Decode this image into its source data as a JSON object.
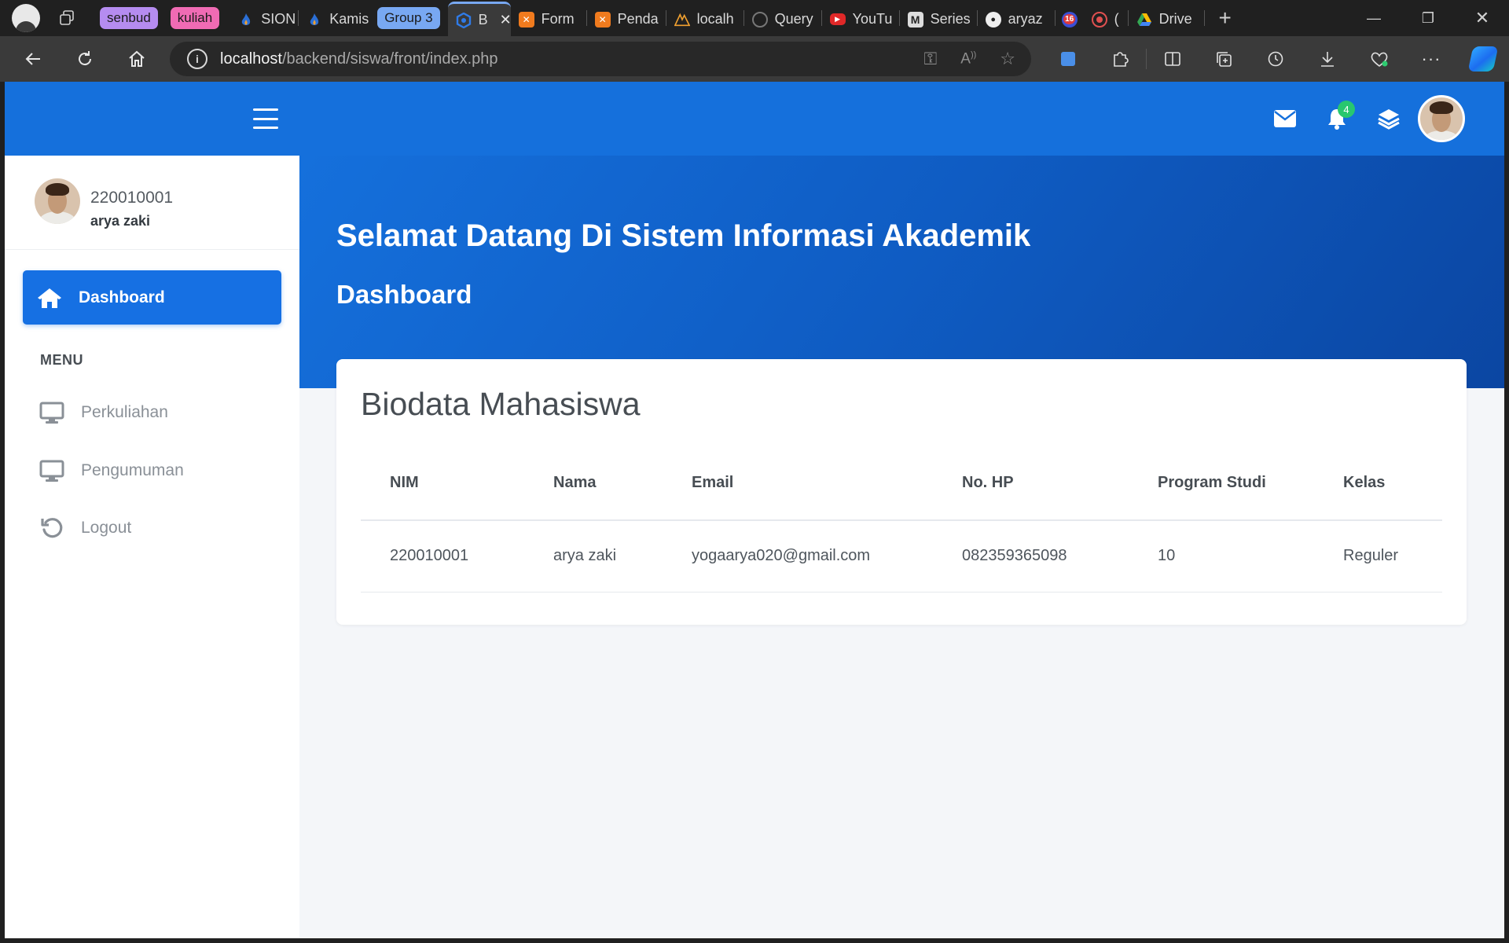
{
  "browser": {
    "tab_groups": [
      {
        "label": "senbud",
        "color": "#b58cf0"
      },
      {
        "label": "kuliah",
        "color": "#f06bb4"
      }
    ],
    "tabs": [
      {
        "title": "SION",
        "favicon": "flame-icon",
        "color": "#2b6fd6"
      },
      {
        "title": "Kamis",
        "favicon": "flame-icon",
        "color": "#2b6fd6"
      },
      {
        "title": "Group 3",
        "is_group": true,
        "color": "#78a8f2"
      },
      {
        "title": "B",
        "favicon": "shield-hex-icon",
        "color": "#2f7be8",
        "active": true
      },
      {
        "title": "Form",
        "favicon": "xampp-icon",
        "color": "#f07b1e"
      },
      {
        "title": "Penda",
        "favicon": "xampp-icon",
        "color": "#f07b1e"
      },
      {
        "title": "localh",
        "favicon": "phpmyadmin-icon",
        "color": "#f0a030"
      },
      {
        "title": "Query",
        "favicon": "chatgpt-icon",
        "color": "#555555"
      },
      {
        "title": "YouTu",
        "favicon": "youtube-icon",
        "color": "#e02828"
      },
      {
        "title": "Series",
        "favicon": "medium-icon",
        "color": "#dddddd"
      },
      {
        "title": "aryaz",
        "favicon": "github-icon",
        "color": "#eeeeee"
      },
      {
        "title": "16",
        "favicon": "badge-icon",
        "color": "#e03a3a"
      },
      {
        "title": "(",
        "favicon": "record-icon",
        "color": "#e05050"
      },
      {
        "title": "Drive",
        "favicon": "drive-icon",
        "color": "#34a853"
      }
    ],
    "url_host": "localhost",
    "url_path": "/backend/siswa/front/index.php"
  },
  "user": {
    "nim": "220010001",
    "name": "arya zaki"
  },
  "sidebar": {
    "active_item": {
      "label": "Dashboard",
      "icon": "home-icon"
    },
    "menu_header": "MENU",
    "items": [
      {
        "label": "Perkuliahan",
        "icon": "monitor-icon"
      },
      {
        "label": "Pengumuman",
        "icon": "monitor-icon"
      },
      {
        "label": "Logout",
        "icon": "undo-icon"
      }
    ]
  },
  "topbar": {
    "notification_count": "4",
    "icons": [
      "envelope-icon",
      "bell-icon",
      "layers-icon",
      "avatar"
    ]
  },
  "hero": {
    "title": "Selamat Datang Di Sistem Informasi Akademik",
    "subtitle": "Dashboard"
  },
  "biodata": {
    "title": "Biodata Mahasiswa",
    "columns": [
      "NIM",
      "Nama",
      "Email",
      "No. HP",
      "Program Studi",
      "Kelas"
    ],
    "rows": [
      [
        "220010001",
        "arya zaki",
        "yogaarya020@gmail.com",
        "082359365098",
        "10",
        "Reguler"
      ]
    ]
  },
  "colors": {
    "primary": "#1570dc",
    "badge": "#28c76f"
  }
}
